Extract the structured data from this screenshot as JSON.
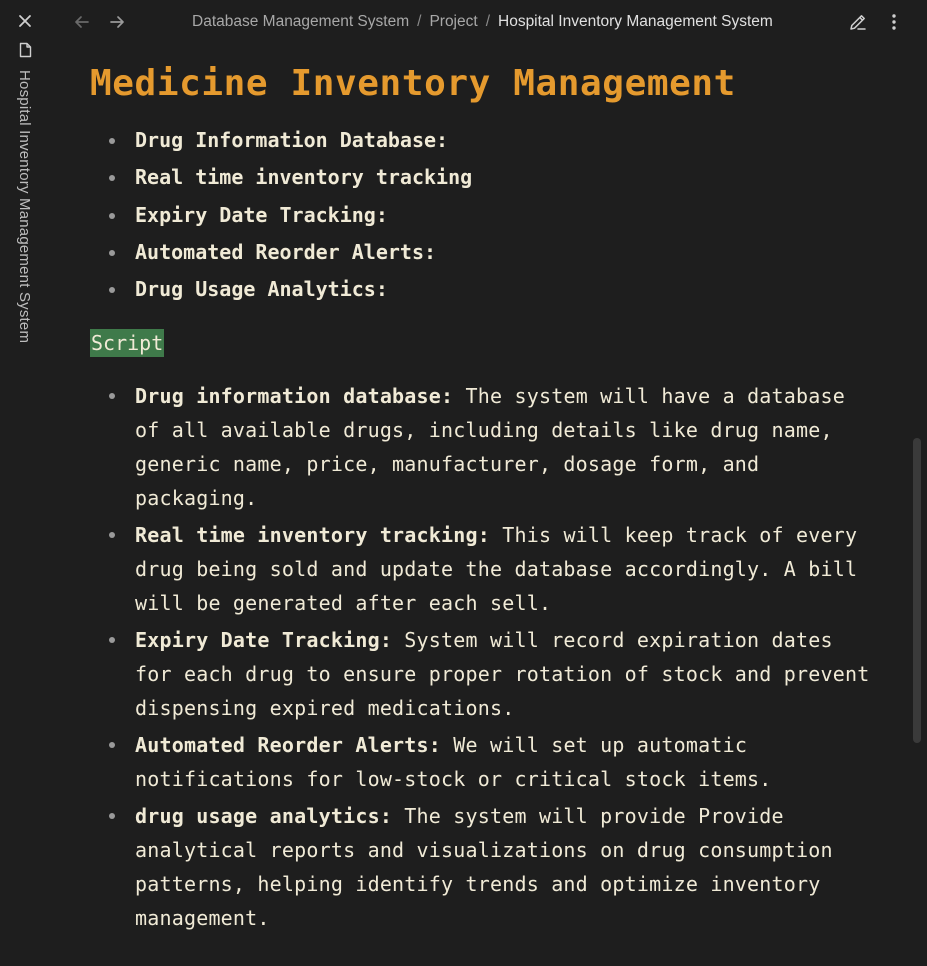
{
  "rail": {
    "title": "Hospital Inventory Management System",
    "close_icon": "close-icon",
    "doc_icon": "document-icon"
  },
  "header": {
    "back_icon": "arrow-left-icon",
    "forward_icon": "arrow-right-icon",
    "breadcrumb": [
      "Database Management System",
      "Project",
      "Hospital Inventory Management System"
    ],
    "separator": "/",
    "edit_icon": "pencil-icon",
    "more_icon": "more-vertical-icon"
  },
  "document": {
    "title": "Medicine Inventory Management",
    "summary": [
      "Drug Information Database:",
      "Real time inventory tracking",
      "Expiry Date Tracking:",
      "Automated Reorder Alerts:",
      "Drug Usage Analytics:"
    ],
    "tag": "Script",
    "details": [
      {
        "term": "Drug information database:",
        "text": " The system will have a database of all available drugs, including details like drug name, generic name, price, manufacturer, dosage form, and packaging."
      },
      {
        "term": "Real time inventory tracking:",
        "text": " This will keep track of every drug being sold and update the database accordingly. A bill will be generated after each sell."
      },
      {
        "term": "Expiry Date Tracking:",
        "text": " System will record expiration dates for each drug to ensure proper rotation of stock and prevent dispensing expired medications."
      },
      {
        "term": "Automated Reorder Alerts:",
        "text": " We will set up automatic notifications for low-stock or critical stock items."
      },
      {
        "term": "drug usage analytics:",
        "text": " The system will provide Provide analytical reports and visualizations on drug consumption patterns, helping identify trends and optimize inventory management."
      }
    ]
  },
  "colors": {
    "background": "#1e1e1e",
    "heading": "#e59a2e",
    "text": "#f0ead6",
    "tag_background": "#3f7a4a"
  }
}
